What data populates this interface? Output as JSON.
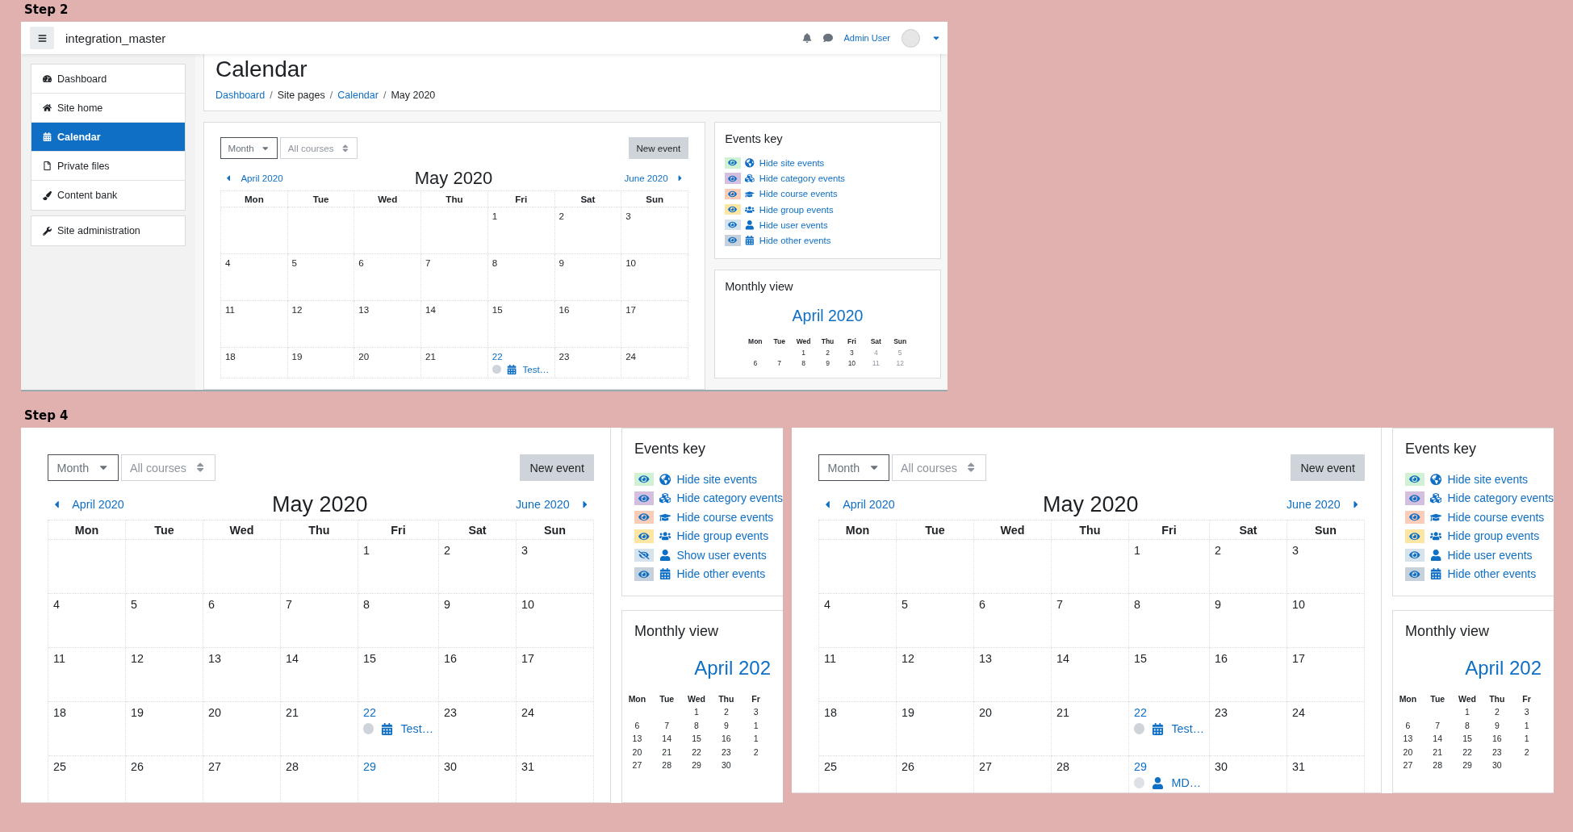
{
  "step2": {
    "label": "Step 2",
    "navbar": {
      "site_name": "integration_master",
      "user_name": "Admin User"
    },
    "sidebar": {
      "items": [
        {
          "label": "Dashboard",
          "kind": "dashboard",
          "selected": false
        },
        {
          "label": "Site home",
          "kind": "home",
          "selected": false
        },
        {
          "label": "Calendar",
          "kind": "calendar",
          "selected": true
        },
        {
          "label": "Private files",
          "kind": "file",
          "selected": false
        },
        {
          "label": "Content bank",
          "kind": "brush",
          "selected": false
        }
      ],
      "admin_item": {
        "label": "Site administration",
        "kind": "wrench",
        "selected": false
      }
    },
    "page_header": {
      "title": "Calendar",
      "separator": "/",
      "breadcrumb": [
        {
          "label": "Dashboard",
          "link": true
        },
        {
          "label": "Site pages",
          "link": false
        },
        {
          "label": "Calendar",
          "link": true
        },
        {
          "label": "May 2020",
          "link": false
        }
      ]
    },
    "calendar": {
      "view_select": "Month",
      "course_select": "All courses",
      "new_event_button": "New event",
      "prev_month": "April 2020",
      "title": "May 2020",
      "next_month": "June 2020",
      "weekdays": [
        "Mon",
        "Tue",
        "Wed",
        "Thu",
        "Fri",
        "Sat",
        "Sun"
      ],
      "weeks": [
        [
          {
            "kind": "blank"
          },
          {
            "kind": "blank"
          },
          {
            "kind": "blank"
          },
          {
            "kind": "blank"
          },
          {
            "kind": "day",
            "day": "1",
            "linked": false
          },
          {
            "kind": "day",
            "day": "2",
            "linked": false
          },
          {
            "kind": "day",
            "day": "3",
            "linked": false
          }
        ],
        [
          {
            "kind": "day",
            "day": "4",
            "linked": false
          },
          {
            "kind": "day",
            "day": "5",
            "linked": false
          },
          {
            "kind": "day",
            "day": "6",
            "linked": false
          },
          {
            "kind": "day",
            "day": "7",
            "linked": false
          },
          {
            "kind": "day",
            "day": "8",
            "linked": false
          },
          {
            "kind": "day",
            "day": "9",
            "linked": false
          },
          {
            "kind": "day",
            "day": "10",
            "linked": false
          }
        ],
        [
          {
            "kind": "day",
            "day": "11",
            "linked": false
          },
          {
            "kind": "day",
            "day": "12",
            "linked": false
          },
          {
            "kind": "day",
            "day": "13",
            "linked": false
          },
          {
            "kind": "day",
            "day": "14",
            "linked": false
          },
          {
            "kind": "day",
            "day": "15",
            "linked": false
          },
          {
            "kind": "day",
            "day": "16",
            "linked": false
          },
          {
            "kind": "day",
            "day": "17",
            "linked": false
          }
        ],
        [
          {
            "kind": "day",
            "day": "18",
            "linked": false
          },
          {
            "kind": "day",
            "day": "19",
            "linked": false
          },
          {
            "kind": "day",
            "day": "20",
            "linked": false
          },
          {
            "kind": "day",
            "day": "21",
            "linked": false
          },
          {
            "kind": "day",
            "day": "22",
            "linked": true,
            "events": [
              {
                "title": "Test…",
                "kind": "other",
                "color": "#ced4da"
              }
            ]
          },
          {
            "kind": "day",
            "day": "23",
            "linked": false
          },
          {
            "kind": "day",
            "day": "24",
            "linked": false
          }
        ]
      ]
    },
    "events_key": {
      "title": "Events key",
      "items": [
        {
          "label": "Hide site events",
          "kind": "site",
          "color": "#d1f1d4",
          "shown": true
        },
        {
          "label": "Hide category events",
          "kind": "category",
          "color": "#d5bfdf",
          "shown": true
        },
        {
          "label": "Hide course events",
          "kind": "course",
          "color": "#fbcdb9",
          "shown": true
        },
        {
          "label": "Hide group events",
          "kind": "group",
          "color": "#fde5a4",
          "shown": true
        },
        {
          "label": "Hide user events",
          "kind": "user",
          "color": "#d7e3ec",
          "shown": true
        },
        {
          "label": "Hide other events",
          "kind": "other",
          "color": "#c7d1db",
          "shown": true
        }
      ]
    },
    "monthly_view": {
      "title": "Monthly view",
      "month": "April 2020",
      "weekdays": [
        "Mon",
        "Tue",
        "Wed",
        "Thu",
        "Fri",
        "Sat",
        "Sun"
      ],
      "weeks": [
        [
          {
            "kind": "blank"
          },
          {
            "kind": "blank"
          },
          {
            "kind": "day",
            "day": "1",
            "muted": false
          },
          {
            "kind": "day",
            "day": "2",
            "muted": false
          },
          {
            "kind": "day",
            "day": "3",
            "muted": false
          },
          {
            "kind": "day",
            "day": "4",
            "muted": true
          },
          {
            "kind": "day",
            "day": "5",
            "muted": true
          }
        ],
        [
          {
            "kind": "day",
            "day": "6",
            "muted": false
          },
          {
            "kind": "day",
            "day": "7",
            "muted": false
          },
          {
            "kind": "day",
            "day": "8",
            "muted": false
          },
          {
            "kind": "day",
            "day": "9",
            "muted": false
          },
          {
            "kind": "day",
            "day": "10",
            "muted": false
          },
          {
            "kind": "day",
            "day": "11",
            "muted": true
          },
          {
            "kind": "day",
            "day": "12",
            "muted": true
          }
        ]
      ]
    }
  },
  "step4": {
    "label": "Step 4",
    "views": [
      {
        "calendar": {
          "view_select": "Month",
          "course_select": "All courses",
          "new_event_button": "New event",
          "prev_month": "April 2020",
          "title": "May 2020",
          "next_month": "June 2020",
          "weekdays": [
            "Mon",
            "Tue",
            "Wed",
            "Thu",
            "Fri",
            "Sat",
            "Sun"
          ],
          "weeks": [
            [
              {
                "kind": "blank"
              },
              {
                "kind": "blank"
              },
              {
                "kind": "blank"
              },
              {
                "kind": "blank"
              },
              {
                "kind": "day",
                "day": "1",
                "linked": false
              },
              {
                "kind": "day",
                "day": "2",
                "linked": false
              },
              {
                "kind": "day",
                "day": "3",
                "linked": false
              }
            ],
            [
              {
                "kind": "day",
                "day": "4",
                "linked": false
              },
              {
                "kind": "day",
                "day": "5",
                "linked": false
              },
              {
                "kind": "day",
                "day": "6",
                "linked": false
              },
              {
                "kind": "day",
                "day": "7",
                "linked": false
              },
              {
                "kind": "day",
                "day": "8",
                "linked": false
              },
              {
                "kind": "day",
                "day": "9",
                "linked": false
              },
              {
                "kind": "day",
                "day": "10",
                "linked": false
              }
            ],
            [
              {
                "kind": "day",
                "day": "11",
                "linked": false
              },
              {
                "kind": "day",
                "day": "12",
                "linked": false
              },
              {
                "kind": "day",
                "day": "13",
                "linked": false
              },
              {
                "kind": "day",
                "day": "14",
                "linked": false
              },
              {
                "kind": "day",
                "day": "15",
                "linked": false
              },
              {
                "kind": "day",
                "day": "16",
                "linked": false
              },
              {
                "kind": "day",
                "day": "17",
                "linked": false
              }
            ],
            [
              {
                "kind": "day",
                "day": "18",
                "linked": false
              },
              {
                "kind": "day",
                "day": "19",
                "linked": false
              },
              {
                "kind": "day",
                "day": "20",
                "linked": false
              },
              {
                "kind": "day",
                "day": "21",
                "linked": false
              },
              {
                "kind": "day",
                "day": "22",
                "linked": true,
                "events": [
                  {
                    "title": "Test…",
                    "kind": "other",
                    "color": "#ced4da"
                  }
                ]
              },
              {
                "kind": "day",
                "day": "23",
                "linked": false
              },
              {
                "kind": "day",
                "day": "24",
                "linked": false
              }
            ],
            [
              {
                "kind": "day",
                "day": "25",
                "linked": false
              },
              {
                "kind": "day",
                "day": "26",
                "linked": false
              },
              {
                "kind": "day",
                "day": "27",
                "linked": false
              },
              {
                "kind": "day",
                "day": "28",
                "linked": false
              },
              {
                "kind": "day",
                "day": "29",
                "linked": true
              },
              {
                "kind": "day",
                "day": "30",
                "linked": false
              },
              {
                "kind": "day",
                "day": "31",
                "linked": false
              }
            ]
          ]
        },
        "events_key": {
          "title": "Events key",
          "items": [
            {
              "label": "Hide site events",
              "kind": "site",
              "color": "#d1f1d4",
              "shown": true
            },
            {
              "label": "Hide category events",
              "kind": "category",
              "color": "#d5bfdf",
              "shown": true
            },
            {
              "label": "Hide course events",
              "kind": "course",
              "color": "#fbcdb9",
              "shown": true
            },
            {
              "label": "Hide group events",
              "kind": "group",
              "color": "#fde5a4",
              "shown": true
            },
            {
              "label": "Show user events",
              "kind": "user",
              "color": "#d7e3ec",
              "shown": false
            },
            {
              "label": "Hide other events",
              "kind": "other",
              "color": "#c7d1db",
              "shown": true
            }
          ]
        },
        "monthly_view": {
          "title": "Monthly view",
          "month": "April 202",
          "weekdays": [
            "Mon",
            "Tue",
            "Wed",
            "Thu",
            "Fr"
          ],
          "weeks": [
            [
              {
                "kind": "blank"
              },
              {
                "kind": "blank"
              },
              {
                "kind": "day",
                "day": "1",
                "muted": false
              },
              {
                "kind": "day",
                "day": "2",
                "muted": false
              },
              {
                "kind": "day",
                "day": "3",
                "muted": false
              }
            ],
            [
              {
                "kind": "day",
                "day": "6",
                "muted": false
              },
              {
                "kind": "day",
                "day": "7",
                "muted": false
              },
              {
                "kind": "day",
                "day": "8",
                "muted": false
              },
              {
                "kind": "day",
                "day": "9",
                "muted": false
              },
              {
                "kind": "day",
                "day": "1",
                "muted": false
              }
            ],
            [
              {
                "kind": "day",
                "day": "13",
                "muted": false
              },
              {
                "kind": "day",
                "day": "14",
                "muted": false
              },
              {
                "kind": "day",
                "day": "15",
                "muted": false
              },
              {
                "kind": "day",
                "day": "16",
                "muted": false
              },
              {
                "kind": "day",
                "day": "1",
                "muted": false
              }
            ],
            [
              {
                "kind": "day",
                "day": "20",
                "muted": false
              },
              {
                "kind": "day",
                "day": "21",
                "muted": false
              },
              {
                "kind": "day",
                "day": "22",
                "muted": false
              },
              {
                "kind": "day",
                "day": "23",
                "muted": false
              },
              {
                "kind": "day",
                "day": "2",
                "muted": false
              }
            ],
            [
              {
                "kind": "day",
                "day": "27",
                "muted": false
              },
              {
                "kind": "day",
                "day": "28",
                "muted": false
              },
              {
                "kind": "day",
                "day": "29",
                "muted": false
              },
              {
                "kind": "day",
                "day": "30",
                "muted": false
              },
              {
                "kind": "blank"
              }
            ]
          ]
        }
      },
      {
        "calendar": {
          "view_select": "Month",
          "course_select": "All courses",
          "new_event_button": "New event",
          "prev_month": "April 2020",
          "title": "May 2020",
          "next_month": "June 2020",
          "weekdays": [
            "Mon",
            "Tue",
            "Wed",
            "Thu",
            "Fri",
            "Sat",
            "Sun"
          ],
          "weeks": [
            [
              {
                "kind": "blank"
              },
              {
                "kind": "blank"
              },
              {
                "kind": "blank"
              },
              {
                "kind": "blank"
              },
              {
                "kind": "day",
                "day": "1",
                "linked": false
              },
              {
                "kind": "day",
                "day": "2",
                "linked": false
              },
              {
                "kind": "day",
                "day": "3",
                "linked": false
              }
            ],
            [
              {
                "kind": "day",
                "day": "4",
                "linked": false
              },
              {
                "kind": "day",
                "day": "5",
                "linked": false
              },
              {
                "kind": "day",
                "day": "6",
                "linked": false
              },
              {
                "kind": "day",
                "day": "7",
                "linked": false
              },
              {
                "kind": "day",
                "day": "8",
                "linked": false
              },
              {
                "kind": "day",
                "day": "9",
                "linked": false
              },
              {
                "kind": "day",
                "day": "10",
                "linked": false
              }
            ],
            [
              {
                "kind": "day",
                "day": "11",
                "linked": false
              },
              {
                "kind": "day",
                "day": "12",
                "linked": false
              },
              {
                "kind": "day",
                "day": "13",
                "linked": false
              },
              {
                "kind": "day",
                "day": "14",
                "linked": false
              },
              {
                "kind": "day",
                "day": "15",
                "linked": false
              },
              {
                "kind": "day",
                "day": "16",
                "linked": false
              },
              {
                "kind": "day",
                "day": "17",
                "linked": false
              }
            ],
            [
              {
                "kind": "day",
                "day": "18",
                "linked": false
              },
              {
                "kind": "day",
                "day": "19",
                "linked": false
              },
              {
                "kind": "day",
                "day": "20",
                "linked": false
              },
              {
                "kind": "day",
                "day": "21",
                "linked": false
              },
              {
                "kind": "day",
                "day": "22",
                "linked": true,
                "events": [
                  {
                    "title": "Test…",
                    "kind": "other",
                    "color": "#ced4da"
                  }
                ]
              },
              {
                "kind": "day",
                "day": "23",
                "linked": false
              },
              {
                "kind": "day",
                "day": "24",
                "linked": false
              }
            ],
            [
              {
                "kind": "day",
                "day": "25",
                "linked": false
              },
              {
                "kind": "day",
                "day": "26",
                "linked": false
              },
              {
                "kind": "day",
                "day": "27",
                "linked": false
              },
              {
                "kind": "day",
                "day": "28",
                "linked": false
              },
              {
                "kind": "day",
                "day": "29",
                "linked": true,
                "events": [
                  {
                    "title": "MD…",
                    "kind": "user",
                    "color": "#dee2e6"
                  }
                ]
              },
              {
                "kind": "day",
                "day": "30",
                "linked": false
              },
              {
                "kind": "day",
                "day": "31",
                "linked": false
              }
            ]
          ]
        },
        "events_key": {
          "title": "Events key",
          "items": [
            {
              "label": "Hide site events",
              "kind": "site",
              "color": "#d1f1d4",
              "shown": true
            },
            {
              "label": "Hide category events",
              "kind": "category",
              "color": "#d5bfdf",
              "shown": true
            },
            {
              "label": "Hide course events",
              "kind": "course",
              "color": "#fbcdb9",
              "shown": true
            },
            {
              "label": "Hide group events",
              "kind": "group",
              "color": "#fde5a4",
              "shown": true
            },
            {
              "label": "Hide user events",
              "kind": "user",
              "color": "#d7e3ec",
              "shown": true
            },
            {
              "label": "Hide other events",
              "kind": "other",
              "color": "#c7d1db",
              "shown": true
            }
          ]
        },
        "monthly_view": {
          "title": "Monthly view",
          "month": "April 202",
          "weekdays": [
            "Mon",
            "Tue",
            "Wed",
            "Thu",
            "Fr"
          ],
          "weeks": [
            [
              {
                "kind": "blank"
              },
              {
                "kind": "blank"
              },
              {
                "kind": "day",
                "day": "1",
                "muted": false
              },
              {
                "kind": "day",
                "day": "2",
                "muted": false
              },
              {
                "kind": "day",
                "day": "3",
                "muted": false
              }
            ],
            [
              {
                "kind": "day",
                "day": "6",
                "muted": false
              },
              {
                "kind": "day",
                "day": "7",
                "muted": false
              },
              {
                "kind": "day",
                "day": "8",
                "muted": false
              },
              {
                "kind": "day",
                "day": "9",
                "muted": false
              },
              {
                "kind": "day",
                "day": "1",
                "muted": false
              }
            ],
            [
              {
                "kind": "day",
                "day": "13",
                "muted": false
              },
              {
                "kind": "day",
                "day": "14",
                "muted": false
              },
              {
                "kind": "day",
                "day": "15",
                "muted": false
              },
              {
                "kind": "day",
                "day": "16",
                "muted": false
              },
              {
                "kind": "day",
                "day": "1",
                "muted": false
              }
            ],
            [
              {
                "kind": "day",
                "day": "20",
                "muted": false
              },
              {
                "kind": "day",
                "day": "21",
                "muted": false
              },
              {
                "kind": "day",
                "day": "22",
                "muted": false
              },
              {
                "kind": "day",
                "day": "23",
                "muted": false
              },
              {
                "kind": "day",
                "day": "2",
                "muted": false
              }
            ],
            [
              {
                "kind": "day",
                "day": "27",
                "muted": false
              },
              {
                "kind": "day",
                "day": "28",
                "muted": false
              },
              {
                "kind": "day",
                "day": "29",
                "muted": false
              },
              {
                "kind": "day",
                "day": "30",
                "muted": false
              },
              {
                "kind": "blank"
              }
            ]
          ]
        }
      }
    ]
  }
}
